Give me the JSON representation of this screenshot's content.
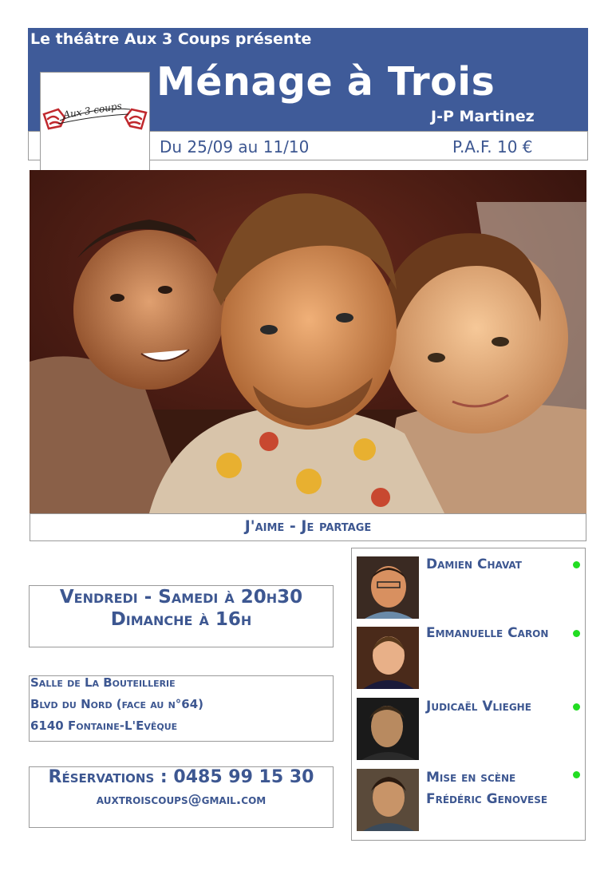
{
  "header": {
    "presents": "Le théâtre Aux 3 Coups présente",
    "title": "Ménage à Trois",
    "author": "J-P Martinez"
  },
  "logo": {
    "text": "Aux 3 coups",
    "accent": "#c0282d"
  },
  "info": {
    "dates": "Du 25/09 au 11/10",
    "price": "P.A.F. 10 €"
  },
  "tagline": "J'aime - Je partage",
  "schedule": {
    "line1": "Vendredi - Samedi à 20h30",
    "line2": "Dimanche à 16h"
  },
  "address": {
    "line1": "Salle de La Bouteillerie",
    "line2": "Blvd du Nord (face au n°64)",
    "line3": "6140 Fontaine-L'Evêque"
  },
  "reservations": {
    "phone": "Réservations : 0485 99 15 30",
    "email": "auxtroiscoups@gmail.com"
  },
  "cast": [
    {
      "name": "Damien Chavat"
    },
    {
      "name": "Emmanuelle Caron"
    },
    {
      "name": "Judicaël Vlieghe"
    },
    {
      "name_line1": "Mise en scène",
      "name_line2": "Frédéric Genovese"
    }
  ],
  "colors": {
    "brand_blue": "#3f5b99",
    "text_blue": "#3d5791",
    "status_green": "#22dd22"
  }
}
